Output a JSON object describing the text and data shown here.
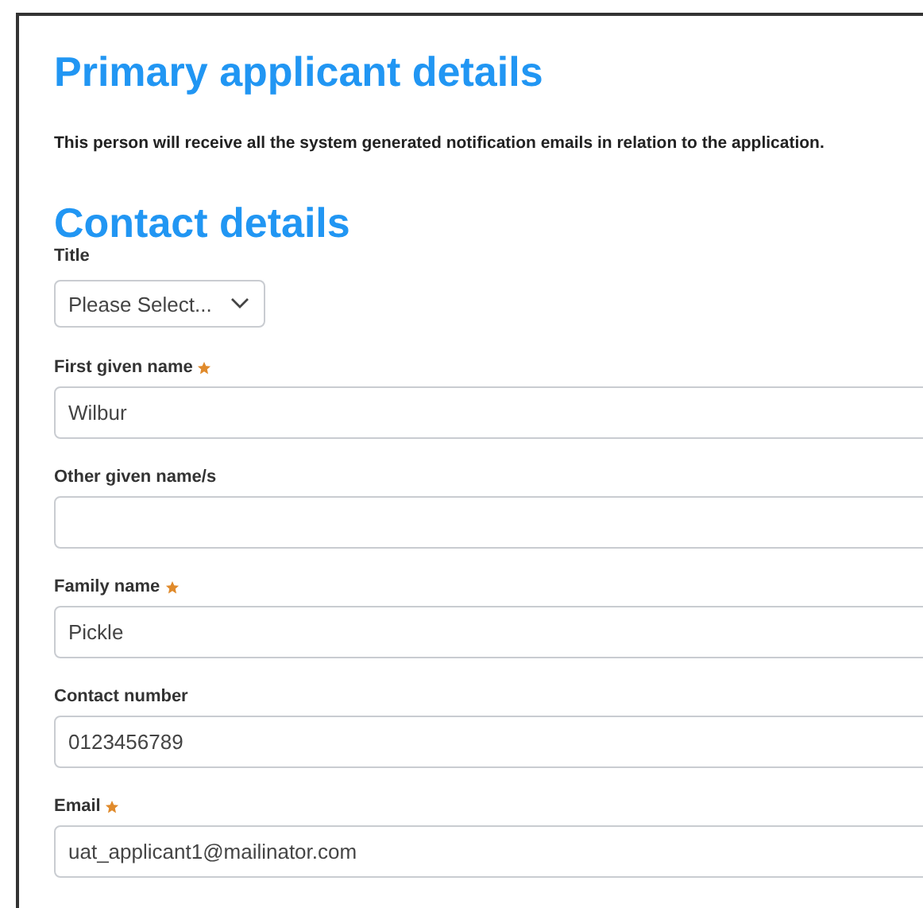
{
  "heading": "Primary applicant details",
  "intro": "This person will receive all the system generated notification emails in relation to the application.",
  "section_heading": "Contact details",
  "title_field": {
    "label": "Title",
    "placeholder": "Please Select..."
  },
  "fields": [
    {
      "label": "First given name",
      "required": true,
      "value": "Wilbur"
    },
    {
      "label": "Other given name/s",
      "required": false
    },
    {
      "label": "Family name",
      "required": true,
      "value": "Pickle"
    },
    {
      "label": "Contact number",
      "required": false,
      "value": "0123456789"
    },
    {
      "label": "Email",
      "required": true,
      "value": "uat_applicant1@mailinator.com"
    }
  ]
}
